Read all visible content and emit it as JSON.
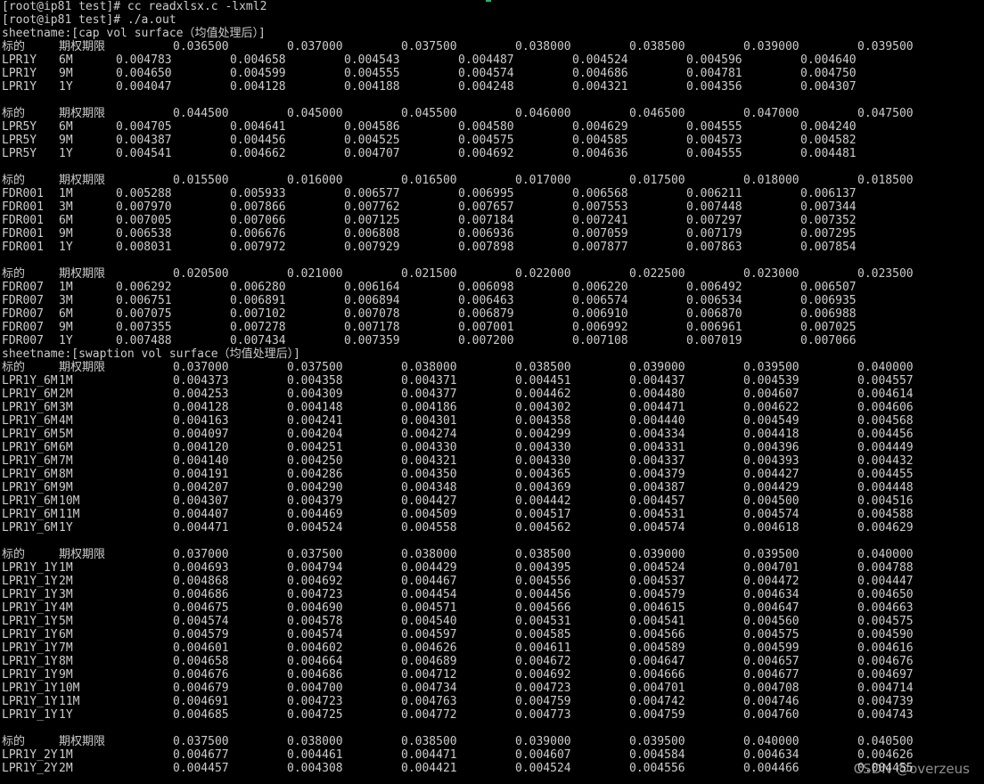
{
  "lines": [
    {
      "type": "text",
      "text": "[root@ip81 test]# cc readxlsx.c -lxml2"
    },
    {
      "type": "text",
      "text": "[root@ip81 test]# ./a.out"
    },
    {
      "type": "text",
      "text": "sheetname:[cap vol surface（均值处理后）]"
    },
    {
      "type": "header",
      "layout": "A",
      "cells": [
        "标的",
        "期权期限",
        "0.036500",
        "0.037000",
        "0.037500",
        "0.038000",
        "0.038500",
        "0.039000",
        "0.039500"
      ]
    },
    {
      "type": "row",
      "layout": "A",
      "cells": [
        "LPR1Y",
        "6M",
        "0.004783",
        "0.004658",
        "0.004543",
        "0.004487",
        "0.004524",
        "0.004596",
        "0.004640"
      ]
    },
    {
      "type": "row",
      "layout": "A",
      "cells": [
        "LPR1Y",
        "9M",
        "0.004650",
        "0.004599",
        "0.004555",
        "0.004574",
        "0.004686",
        "0.004781",
        "0.004750"
      ]
    },
    {
      "type": "row",
      "layout": "A",
      "cells": [
        "LPR1Y",
        "1Y",
        "0.004047",
        "0.004128",
        "0.004188",
        "0.004248",
        "0.004321",
        "0.004356",
        "0.004307"
      ]
    },
    {
      "type": "blank"
    },
    {
      "type": "header",
      "layout": "B",
      "cells": [
        "标的",
        "期权期限",
        "0.044500",
        "0.045000",
        "0.045500",
        "0.046000",
        "0.046500",
        "0.047000",
        "0.047500"
      ]
    },
    {
      "type": "row",
      "layout": "A",
      "cells": [
        "LPR5Y",
        "6M",
        "0.004705",
        "0.004641",
        "0.004586",
        "0.004580",
        "0.004629",
        "0.004555",
        "0.004240"
      ]
    },
    {
      "type": "row",
      "layout": "A",
      "cells": [
        "LPR5Y",
        "9M",
        "0.004387",
        "0.004456",
        "0.004525",
        "0.004575",
        "0.004585",
        "0.004573",
        "0.004582"
      ]
    },
    {
      "type": "row",
      "layout": "A",
      "cells": [
        "LPR5Y",
        "1Y",
        "0.004541",
        "0.004662",
        "0.004707",
        "0.004692",
        "0.004636",
        "0.004555",
        "0.004481"
      ]
    },
    {
      "type": "blank"
    },
    {
      "type": "header",
      "layout": "B",
      "cells": [
        "标的",
        "期权期限",
        "0.015500",
        "0.016000",
        "0.016500",
        "0.017000",
        "0.017500",
        "0.018000",
        "0.018500"
      ]
    },
    {
      "type": "row",
      "layout": "A",
      "cells": [
        "FDR001",
        "1M",
        "0.005288",
        "0.005933",
        "0.006577",
        "0.006995",
        "0.006568",
        "0.006211",
        "0.006137"
      ]
    },
    {
      "type": "row",
      "layout": "A",
      "cells": [
        "FDR001",
        "3M",
        "0.007970",
        "0.007866",
        "0.007762",
        "0.007657",
        "0.007553",
        "0.007448",
        "0.007344"
      ]
    },
    {
      "type": "row",
      "layout": "A",
      "cells": [
        "FDR001",
        "6M",
        "0.007005",
        "0.007066",
        "0.007125",
        "0.007184",
        "0.007241",
        "0.007297",
        "0.007352"
      ]
    },
    {
      "type": "row",
      "layout": "A",
      "cells": [
        "FDR001",
        "9M",
        "0.006538",
        "0.006676",
        "0.006808",
        "0.006936",
        "0.007059",
        "0.007179",
        "0.007295"
      ]
    },
    {
      "type": "row",
      "layout": "A",
      "cells": [
        "FDR001",
        "1Y",
        "0.008031",
        "0.007972",
        "0.007929",
        "0.007898",
        "0.007877",
        "0.007863",
        "0.007854"
      ]
    },
    {
      "type": "blank"
    },
    {
      "type": "header",
      "layout": "B",
      "cells": [
        "标的",
        "期权期限",
        "0.020500",
        "0.021000",
        "0.021500",
        "0.022000",
        "0.022500",
        "0.023000",
        "0.023500"
      ]
    },
    {
      "type": "row",
      "layout": "A",
      "cells": [
        "FDR007",
        "1M",
        "0.006292",
        "0.006280",
        "0.006164",
        "0.006098",
        "0.006220",
        "0.006492",
        "0.006507"
      ]
    },
    {
      "type": "row",
      "layout": "A",
      "cells": [
        "FDR007",
        "3M",
        "0.006751",
        "0.006891",
        "0.006894",
        "0.006463",
        "0.006574",
        "0.006534",
        "0.006935"
      ]
    },
    {
      "type": "row",
      "layout": "A",
      "cells": [
        "FDR007",
        "6M",
        "0.007075",
        "0.007102",
        "0.007078",
        "0.006879",
        "0.006910",
        "0.006870",
        "0.006988"
      ]
    },
    {
      "type": "row",
      "layout": "A",
      "cells": [
        "FDR007",
        "9M",
        "0.007355",
        "0.007278",
        "0.007178",
        "0.007001",
        "0.006992",
        "0.006961",
        "0.007025"
      ]
    },
    {
      "type": "row",
      "layout": "A",
      "cells": [
        "FDR007",
        "1Y",
        "0.007488",
        "0.007434",
        "0.007359",
        "0.007200",
        "0.007108",
        "0.007019",
        "0.007066"
      ]
    },
    {
      "type": "text",
      "text": "sheetname:[swaption vol surface（均值处理后）]"
    },
    {
      "type": "header",
      "layout": "C",
      "cells": [
        "标的",
        "期权期限",
        "0.037000",
        "0.037500",
        "0.038000",
        "0.038500",
        "0.039000",
        "0.039500",
        "0.040000"
      ]
    },
    {
      "type": "row",
      "layout": "B",
      "cells": [
        "LPR1Y_6M",
        "1M",
        "0.004373",
        "0.004358",
        "0.004371",
        "0.004451",
        "0.004437",
        "0.004539",
        "0.004557"
      ]
    },
    {
      "type": "row",
      "layout": "B",
      "cells": [
        "LPR1Y_6M",
        "2M",
        "0.004253",
        "0.004309",
        "0.004377",
        "0.004462",
        "0.004480",
        "0.004607",
        "0.004614"
      ]
    },
    {
      "type": "row",
      "layout": "B",
      "cells": [
        "LPR1Y_6M",
        "3M",
        "0.004128",
        "0.004148",
        "0.004186",
        "0.004302",
        "0.004471",
        "0.004622",
        "0.004606"
      ]
    },
    {
      "type": "row",
      "layout": "B",
      "cells": [
        "LPR1Y_6M",
        "4M",
        "0.004163",
        "0.004241",
        "0.004301",
        "0.004358",
        "0.004440",
        "0.004549",
        "0.004568"
      ]
    },
    {
      "type": "row",
      "layout": "B",
      "cells": [
        "LPR1Y_6M",
        "5M",
        "0.004097",
        "0.004204",
        "0.004274",
        "0.004299",
        "0.004334",
        "0.004418",
        "0.004456"
      ]
    },
    {
      "type": "row",
      "layout": "B",
      "cells": [
        "LPR1Y_6M",
        "6M",
        "0.004120",
        "0.004251",
        "0.004330",
        "0.004330",
        "0.004331",
        "0.004396",
        "0.004449"
      ]
    },
    {
      "type": "row",
      "layout": "B",
      "cells": [
        "LPR1Y_6M",
        "7M",
        "0.004140",
        "0.004250",
        "0.004321",
        "0.004330",
        "0.004337",
        "0.004393",
        "0.004432"
      ]
    },
    {
      "type": "row",
      "layout": "B",
      "cells": [
        "LPR1Y_6M",
        "8M",
        "0.004191",
        "0.004286",
        "0.004350",
        "0.004365",
        "0.004379",
        "0.004427",
        "0.004455"
      ]
    },
    {
      "type": "row",
      "layout": "B",
      "cells": [
        "LPR1Y_6M",
        "9M",
        "0.004207",
        "0.004290",
        "0.004348",
        "0.004369",
        "0.004387",
        "0.004429",
        "0.004448"
      ]
    },
    {
      "type": "row",
      "layout": "B",
      "cells": [
        "LPR1Y_6M",
        "10M",
        "0.004307",
        "0.004379",
        "0.004427",
        "0.004442",
        "0.004457",
        "0.004500",
        "0.004516"
      ]
    },
    {
      "type": "row",
      "layout": "B",
      "cells": [
        "LPR1Y_6M",
        "11M",
        "0.004407",
        "0.004469",
        "0.004509",
        "0.004517",
        "0.004531",
        "0.004574",
        "0.004588"
      ]
    },
    {
      "type": "row",
      "layout": "B",
      "cells": [
        "LPR1Y_6M",
        "1Y",
        "0.004471",
        "0.004524",
        "0.004558",
        "0.004562",
        "0.004574",
        "0.004618",
        "0.004629"
      ]
    },
    {
      "type": "blank"
    },
    {
      "type": "header",
      "layout": "C",
      "cells": [
        "标的",
        "期权期限",
        "0.037000",
        "0.037500",
        "0.038000",
        "0.038500",
        "0.039000",
        "0.039500",
        "0.040000"
      ]
    },
    {
      "type": "row",
      "layout": "B",
      "cells": [
        "LPR1Y_1Y",
        "1M",
        "0.004693",
        "0.004794",
        "0.004429",
        "0.004395",
        "0.004524",
        "0.004701",
        "0.004788"
      ]
    },
    {
      "type": "row",
      "layout": "B",
      "cells": [
        "LPR1Y_1Y",
        "2M",
        "0.004868",
        "0.004692",
        "0.004467",
        "0.004556",
        "0.004537",
        "0.004472",
        "0.004447"
      ]
    },
    {
      "type": "row",
      "layout": "B",
      "cells": [
        "LPR1Y_1Y",
        "3M",
        "0.004686",
        "0.004723",
        "0.004454",
        "0.004456",
        "0.004579",
        "0.004634",
        "0.004650"
      ]
    },
    {
      "type": "row",
      "layout": "B",
      "cells": [
        "LPR1Y_1Y",
        "4M",
        "0.004675",
        "0.004690",
        "0.004571",
        "0.004566",
        "0.004615",
        "0.004647",
        "0.004663"
      ]
    },
    {
      "type": "row",
      "layout": "B",
      "cells": [
        "LPR1Y_1Y",
        "5M",
        "0.004574",
        "0.004578",
        "0.004540",
        "0.004531",
        "0.004541",
        "0.004560",
        "0.004575"
      ]
    },
    {
      "type": "row",
      "layout": "B",
      "cells": [
        "LPR1Y_1Y",
        "6M",
        "0.004579",
        "0.004574",
        "0.004597",
        "0.004585",
        "0.004566",
        "0.004575",
        "0.004590"
      ]
    },
    {
      "type": "row",
      "layout": "B",
      "cells": [
        "LPR1Y_1Y",
        "7M",
        "0.004601",
        "0.004602",
        "0.004626",
        "0.004611",
        "0.004589",
        "0.004599",
        "0.004616"
      ]
    },
    {
      "type": "row",
      "layout": "B",
      "cells": [
        "LPR1Y_1Y",
        "8M",
        "0.004658",
        "0.004664",
        "0.004689",
        "0.004672",
        "0.004647",
        "0.004657",
        "0.004676"
      ]
    },
    {
      "type": "row",
      "layout": "B",
      "cells": [
        "LPR1Y_1Y",
        "9M",
        "0.004676",
        "0.004686",
        "0.004712",
        "0.004692",
        "0.004666",
        "0.004677",
        "0.004697"
      ]
    },
    {
      "type": "row",
      "layout": "B",
      "cells": [
        "LPR1Y_1Y",
        "10M",
        "0.004679",
        "0.004700",
        "0.004734",
        "0.004723",
        "0.004701",
        "0.004708",
        "0.004714"
      ]
    },
    {
      "type": "row",
      "layout": "B",
      "cells": [
        "LPR1Y_1Y",
        "11M",
        "0.004691",
        "0.004723",
        "0.004763",
        "0.004759",
        "0.004742",
        "0.004746",
        "0.004739"
      ]
    },
    {
      "type": "row",
      "layout": "B",
      "cells": [
        "LPR1Y_1Y",
        "1Y",
        "0.004685",
        "0.004725",
        "0.004772",
        "0.004773",
        "0.004759",
        "0.004760",
        "0.004743"
      ]
    },
    {
      "type": "blank"
    },
    {
      "type": "header",
      "layout": "C",
      "cells": [
        "标的",
        "期权期限",
        "0.037500",
        "0.038000",
        "0.038500",
        "0.039000",
        "0.039500",
        "0.040000",
        "0.040500"
      ]
    },
    {
      "type": "row",
      "layout": "B",
      "cells": [
        "LPR1Y_2Y",
        "1M",
        "0.004677",
        "0.004461",
        "0.004471",
        "0.004607",
        "0.004584",
        "0.004634",
        "0.004626"
      ]
    },
    {
      "type": "row",
      "layout": "B",
      "cells": [
        "LPR1Y_2Y",
        "2M",
        "0.004457",
        "0.004308",
        "0.004421",
        "0.004524",
        "0.004556",
        "0.004466",
        "0.004455"
      ]
    }
  ],
  "watermark": "CSDN @overzeus",
  "colors": {
    "background": "#000000",
    "foreground": "#cccccc",
    "cursor": "#1dbb6d"
  }
}
